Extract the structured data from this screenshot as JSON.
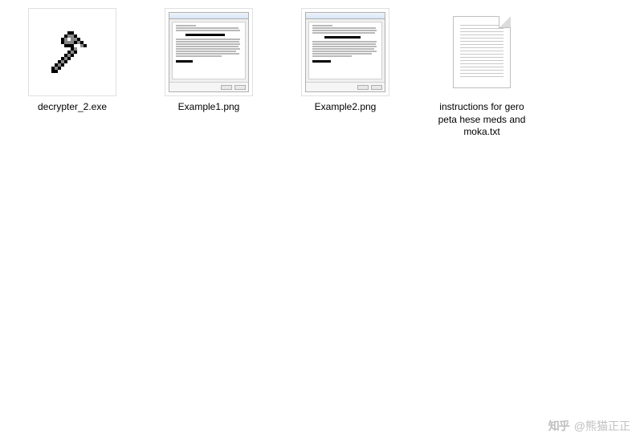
{
  "files": [
    {
      "name": "decrypter_2.exe",
      "kind": "exe"
    },
    {
      "name": "Example1.png",
      "kind": "png"
    },
    {
      "name": "Example2.png",
      "kind": "png"
    },
    {
      "name": "instructions for gero peta hese meds and moka.txt",
      "kind": "txt"
    }
  ],
  "watermark": {
    "brand": "知乎",
    "author": "@熊猫正正"
  }
}
